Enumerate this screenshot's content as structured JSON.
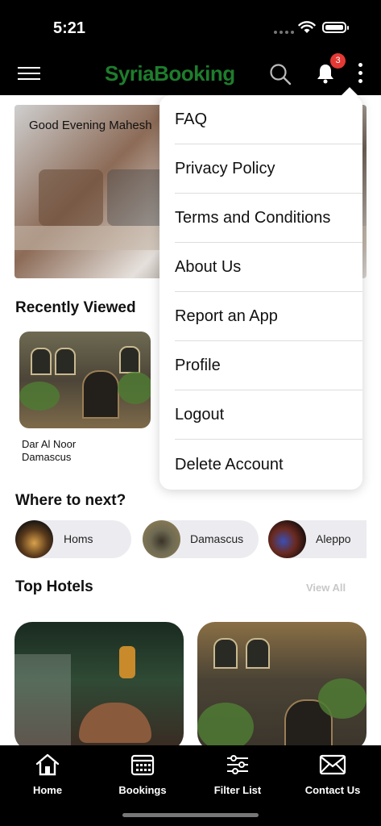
{
  "status_bar": {
    "time": "5:21"
  },
  "header": {
    "logo": "SyriaBooking",
    "notification_count": "3",
    "brand_color": "#1e7d2c",
    "badge_color": "#e53935"
  },
  "hero": {
    "greeting": "Good Evening Mahesh"
  },
  "recently_viewed": {
    "title": "Recently Viewed",
    "items": [
      {
        "name_line1": "Dar Al Noor",
        "name_line2": "Damascus"
      }
    ]
  },
  "where_next": {
    "title": "Where to next?",
    "cities": [
      {
        "label": "Homs"
      },
      {
        "label": "Damascus"
      },
      {
        "label": "Aleppo"
      }
    ]
  },
  "top_hotels": {
    "title": "Top Hotels",
    "view_all": "View All"
  },
  "menu": {
    "items": [
      {
        "label": "FAQ"
      },
      {
        "label": "Privacy Policy"
      },
      {
        "label": "Terms and Conditions"
      },
      {
        "label": "About Us"
      },
      {
        "label": "Report an App"
      },
      {
        "label": "Profile"
      },
      {
        "label": "Logout"
      },
      {
        "label": "Delete Account"
      }
    ]
  },
  "bottom_nav": {
    "items": [
      {
        "label": "Home",
        "icon": "home-icon"
      },
      {
        "label": "Bookings",
        "icon": "calendar-icon"
      },
      {
        "label": "Filter List",
        "icon": "sliders-icon"
      },
      {
        "label": "Contact Us",
        "icon": "mail-icon"
      }
    ]
  }
}
